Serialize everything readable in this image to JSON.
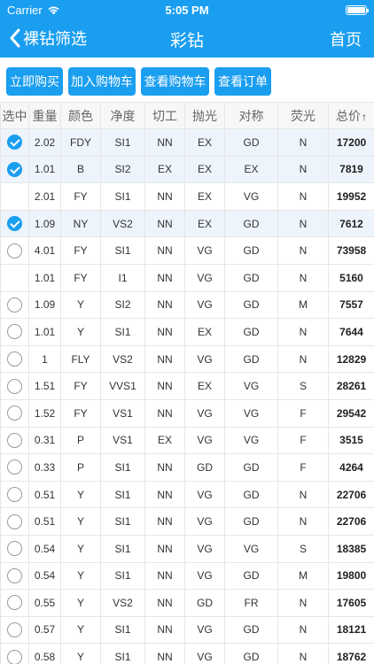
{
  "status": {
    "carrier": "Carrier",
    "time": "5:05 PM",
    "battery_level": 1.0
  },
  "nav": {
    "back_label": "裸钻筛选",
    "title": "彩钻",
    "home_label": "首页"
  },
  "toolbar": {
    "buy_now": "立即购买",
    "add_cart": "加入购物车",
    "view_cart": "查看购物车",
    "view_orders": "查看订单"
  },
  "table": {
    "headers": [
      "选中",
      "重量",
      "颜色",
      "净度",
      "切工",
      "抛光",
      "对称",
      "荧光",
      "总价"
    ],
    "sort_indicator": "↑",
    "rows": [
      {
        "selected": "on",
        "weight": "2.02",
        "color": "FDY",
        "clarity": "SI1",
        "cut": "NN",
        "polish": "EX",
        "symmetry": "GD",
        "fluor": "N",
        "price": "17200"
      },
      {
        "selected": "on",
        "weight": "1.01",
        "color": "B",
        "clarity": "SI2",
        "cut": "EX",
        "polish": "EX",
        "symmetry": "EX",
        "fluor": "N",
        "price": "7819"
      },
      {
        "selected": "none",
        "weight": "2.01",
        "color": "FY",
        "clarity": "SI1",
        "cut": "NN",
        "polish": "EX",
        "symmetry": "VG",
        "fluor": "N",
        "price": "19952"
      },
      {
        "selected": "on",
        "weight": "1.09",
        "color": "NY",
        "clarity": "VS2",
        "cut": "NN",
        "polish": "EX",
        "symmetry": "GD",
        "fluor": "N",
        "price": "7612"
      },
      {
        "selected": "off",
        "weight": "4.01",
        "color": "FY",
        "clarity": "SI1",
        "cut": "NN",
        "polish": "VG",
        "symmetry": "GD",
        "fluor": "N",
        "price": "73958"
      },
      {
        "selected": "none",
        "weight": "1.01",
        "color": "FY",
        "clarity": "I1",
        "cut": "NN",
        "polish": "VG",
        "symmetry": "GD",
        "fluor": "N",
        "price": "5160"
      },
      {
        "selected": "off",
        "weight": "1.09",
        "color": "Y",
        "clarity": "SI2",
        "cut": "NN",
        "polish": "VG",
        "symmetry": "GD",
        "fluor": "M",
        "price": "7557"
      },
      {
        "selected": "off",
        "weight": "1.01",
        "color": "Y",
        "clarity": "SI1",
        "cut": "NN",
        "polish": "EX",
        "symmetry": "GD",
        "fluor": "N",
        "price": "7644"
      },
      {
        "selected": "off",
        "weight": "1",
        "color": "FLY",
        "clarity": "VS2",
        "cut": "NN",
        "polish": "VG",
        "symmetry": "GD",
        "fluor": "N",
        "price": "12829"
      },
      {
        "selected": "off",
        "weight": "1.51",
        "color": "FY",
        "clarity": "VVS1",
        "cut": "NN",
        "polish": "EX",
        "symmetry": "VG",
        "fluor": "S",
        "price": "28261"
      },
      {
        "selected": "off",
        "weight": "1.52",
        "color": "FY",
        "clarity": "VS1",
        "cut": "NN",
        "polish": "VG",
        "symmetry": "VG",
        "fluor": "F",
        "price": "29542"
      },
      {
        "selected": "off",
        "weight": "0.31",
        "color": "P",
        "clarity": "VS1",
        "cut": "EX",
        "polish": "VG",
        "symmetry": "VG",
        "fluor": "F",
        "price": "3515"
      },
      {
        "selected": "off",
        "weight": "0.33",
        "color": "P",
        "clarity": "SI1",
        "cut": "NN",
        "polish": "GD",
        "symmetry": "GD",
        "fluor": "F",
        "price": "4264"
      },
      {
        "selected": "off",
        "weight": "0.51",
        "color": "Y",
        "clarity": "SI1",
        "cut": "NN",
        "polish": "VG",
        "symmetry": "GD",
        "fluor": "N",
        "price": "22706"
      },
      {
        "selected": "off",
        "weight": "0.51",
        "color": "Y",
        "clarity": "SI1",
        "cut": "NN",
        "polish": "VG",
        "symmetry": "GD",
        "fluor": "N",
        "price": "22706"
      },
      {
        "selected": "off",
        "weight": "0.54",
        "color": "Y",
        "clarity": "SI1",
        "cut": "NN",
        "polish": "VG",
        "symmetry": "VG",
        "fluor": "S",
        "price": "18385"
      },
      {
        "selected": "off",
        "weight": "0.54",
        "color": "Y",
        "clarity": "SI1",
        "cut": "NN",
        "polish": "VG",
        "symmetry": "GD",
        "fluor": "M",
        "price": "19800"
      },
      {
        "selected": "off",
        "weight": "0.55",
        "color": "Y",
        "clarity": "VS2",
        "cut": "NN",
        "polish": "GD",
        "symmetry": "FR",
        "fluor": "N",
        "price": "17605"
      },
      {
        "selected": "off",
        "weight": "0.57",
        "color": "Y",
        "clarity": "SI1",
        "cut": "NN",
        "polish": "VG",
        "symmetry": "GD",
        "fluor": "N",
        "price": "18121"
      },
      {
        "selected": "off",
        "weight": "0.58",
        "color": "Y",
        "clarity": "SI1",
        "cut": "NN",
        "polish": "VG",
        "symmetry": "GD",
        "fluor": "N",
        "price": "18762"
      }
    ]
  },
  "colors": {
    "accent": "#1a9ef0",
    "selected_row": "#eef4fb"
  }
}
